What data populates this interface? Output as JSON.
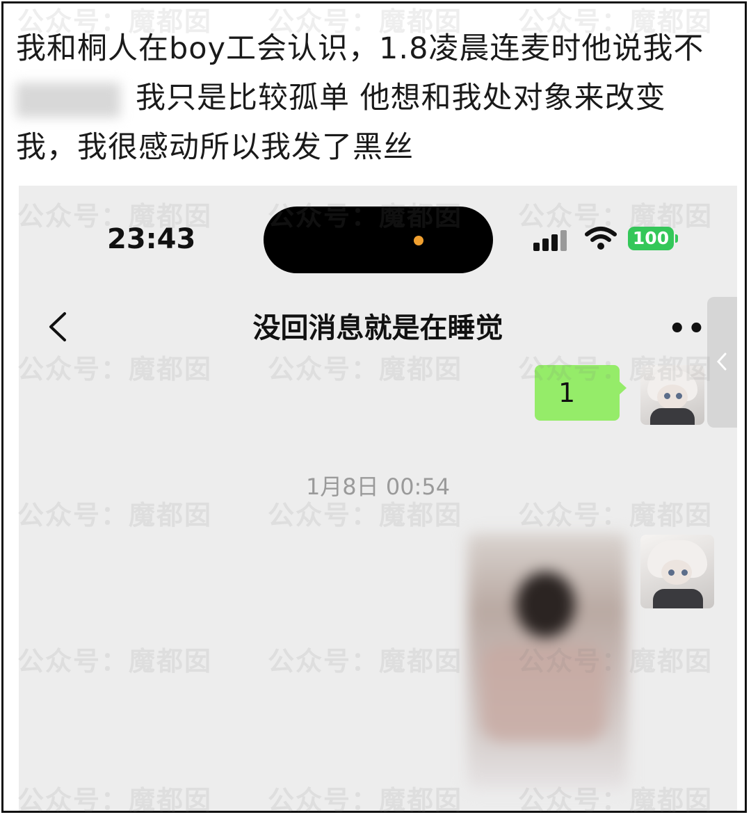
{
  "post": {
    "lines": [
      "我和桐人在boy工会认识，1.8凌晨连麦时他说我不",
      "我只是比较孤单 他想和我处对象来改变",
      "我，我很感动所以我发了黑丝"
    ]
  },
  "status_bar": {
    "time": "23:43",
    "battery": "100",
    "icons": [
      "signal-icon",
      "wifi-icon"
    ]
  },
  "chat": {
    "title": "没回消息就是在睡觉",
    "back_icon": "chevron-left-icon",
    "more_icon": "more-dots-icon",
    "more_label": "•••",
    "messages": [
      {
        "type": "text",
        "text": "1"
      }
    ],
    "timestamp": "1月8日 00:54"
  },
  "watermark": "公众号：魔都囡"
}
